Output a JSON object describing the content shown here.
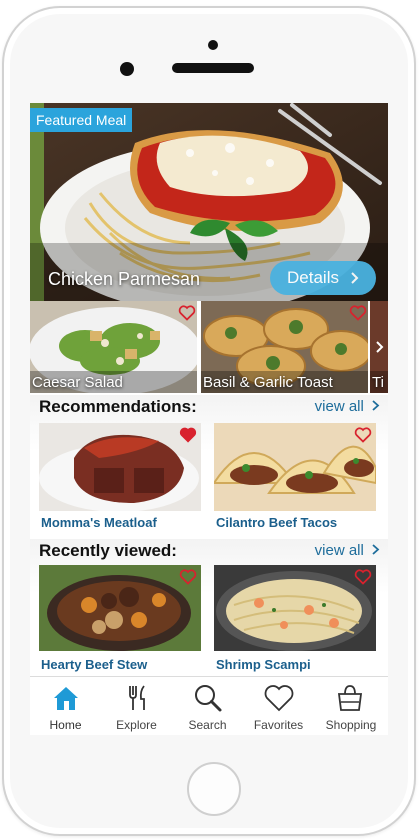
{
  "featured": {
    "badge": "Featured Meal",
    "title": "Chicken Parmesan",
    "details_label": "Details",
    "details_icon": "chevron-right-icon"
  },
  "carousel": {
    "items": [
      {
        "label": "Caesar Salad",
        "favorited": false
      },
      {
        "label": "Basil & Garlic Toast",
        "favorited": false
      },
      {
        "label": "Ti",
        "favorited": false
      }
    ],
    "next_icon": "chevron-right-icon"
  },
  "recommendations": {
    "heading": "Recommendations:",
    "view_all": "view all",
    "items": [
      {
        "label": "Momma's Meatloaf",
        "favorited": true
      },
      {
        "label": "Cilantro Beef Tacos",
        "favorited": false
      }
    ]
  },
  "recent": {
    "heading": "Recently viewed:",
    "view_all": "view all",
    "items": [
      {
        "label": "Hearty Beef Stew",
        "favorited": false
      },
      {
        "label": "Shrimp Scampi",
        "favorited": false
      }
    ]
  },
  "tabbar": {
    "tabs": [
      {
        "label": "Home",
        "icon": "house-icon",
        "active": true
      },
      {
        "label": "Explore",
        "icon": "fork-knife-icon",
        "active": false
      },
      {
        "label": "Search",
        "icon": "search-icon",
        "active": false
      },
      {
        "label": "Favorites",
        "icon": "heart-icon",
        "active": false
      },
      {
        "label": "Shopping",
        "icon": "shopping-bag-icon",
        "active": false
      }
    ]
  },
  "colors": {
    "accent": "#2ba4dc",
    "link": "#1e6d9b",
    "heart_filled": "#d8222e",
    "active_tab_icon": "#1f9ad6"
  }
}
